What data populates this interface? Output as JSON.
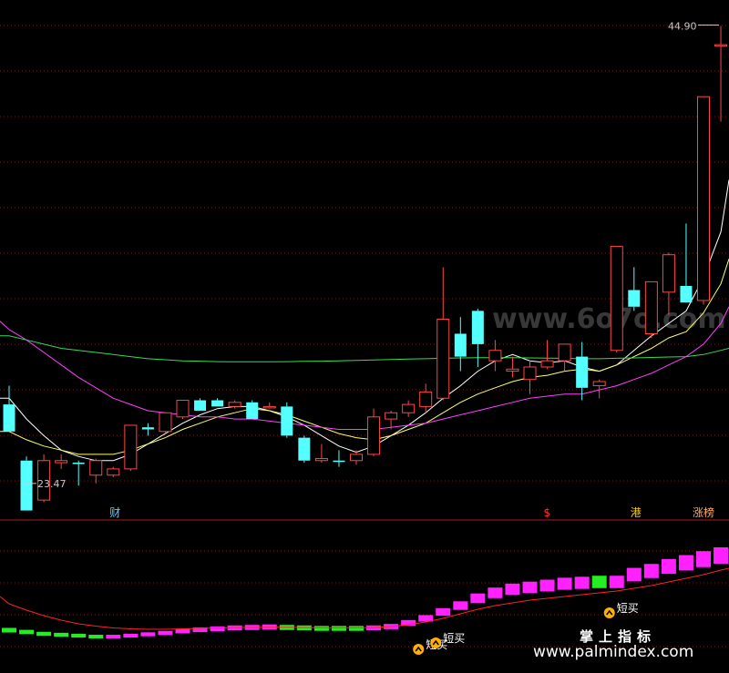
{
  "chart_data": [
    {
      "type": "candlestick",
      "price_labels": {
        "high": "44.90",
        "low": "23.47"
      },
      "ylim": [
        22.5,
        45.8
      ],
      "candles": [
        {
          "o": 26.7,
          "h": 27.6,
          "l": 25.5,
          "c": 25.4,
          "dir": "down"
        },
        {
          "o": 24.0,
          "h": 24.2,
          "l": 23.47,
          "c": 21.6,
          "dir": "down"
        },
        {
          "o": 22.1,
          "h": 24.3,
          "l": 22.0,
          "c": 24.0,
          "dir": "up"
        },
        {
          "o": 24.0,
          "h": 24.3,
          "l": 23.6,
          "c": 23.9,
          "dir": "up"
        },
        {
          "o": 23.9,
          "h": 24.0,
          "l": 22.8,
          "c": 23.85,
          "dir": "down"
        },
        {
          "o": 23.3,
          "h": 24.1,
          "l": 22.9,
          "c": 24.0,
          "dir": "up"
        },
        {
          "o": 23.3,
          "h": 23.7,
          "l": 23.2,
          "c": 23.6,
          "dir": "up"
        },
        {
          "o": 23.6,
          "h": 25.7,
          "l": 23.5,
          "c": 25.7,
          "dir": "up"
        },
        {
          "o": 25.6,
          "h": 25.8,
          "l": 25.2,
          "c": 25.5,
          "dir": "down"
        },
        {
          "o": 25.4,
          "h": 26.3,
          "l": 25.3,
          "c": 26.3,
          "dir": "up"
        },
        {
          "o": 26.1,
          "h": 26.8,
          "l": 26.0,
          "c": 26.9,
          "dir": "up"
        },
        {
          "o": 26.9,
          "h": 27.0,
          "l": 26.4,
          "c": 26.4,
          "dir": "down"
        },
        {
          "o": 26.9,
          "h": 27.0,
          "l": 26.6,
          "c": 26.6,
          "dir": "down"
        },
        {
          "o": 26.6,
          "h": 26.9,
          "l": 26.5,
          "c": 26.8,
          "dir": "up"
        },
        {
          "o": 26.8,
          "h": 26.9,
          "l": 26.0,
          "c": 26.0,
          "dir": "down"
        },
        {
          "o": 26.6,
          "h": 26.8,
          "l": 26.5,
          "c": 26.6,
          "dir": "up"
        },
        {
          "o": 26.6,
          "h": 26.8,
          "l": 25.1,
          "c": 25.2,
          "dir": "down"
        },
        {
          "o": 25.1,
          "h": 25.2,
          "l": 23.9,
          "c": 24.0,
          "dir": "down"
        },
        {
          "o": 24.0,
          "h": 24.8,
          "l": 23.9,
          "c": 24.1,
          "dir": "up"
        },
        {
          "o": 24.0,
          "h": 24.5,
          "l": 23.7,
          "c": 24.0,
          "dir": "down"
        },
        {
          "o": 24.0,
          "h": 24.5,
          "l": 23.8,
          "c": 24.3,
          "dir": "up"
        },
        {
          "o": 24.3,
          "h": 26.5,
          "l": 24.2,
          "c": 26.1,
          "dir": "up"
        },
        {
          "o": 26.0,
          "h": 26.4,
          "l": 25.5,
          "c": 26.3,
          "dir": "up"
        },
        {
          "o": 26.3,
          "h": 26.9,
          "l": 26.1,
          "c": 26.7,
          "dir": "up"
        },
        {
          "o": 26.6,
          "h": 27.7,
          "l": 26.3,
          "c": 27.3,
          "dir": "up"
        },
        {
          "o": 27.0,
          "h": 33.3,
          "l": 26.9,
          "c": 30.8,
          "dir": "up"
        },
        {
          "o": 30.1,
          "h": 30.9,
          "l": 28.3,
          "c": 29.0,
          "dir": "down"
        },
        {
          "o": 31.2,
          "h": 31.3,
          "l": 28.5,
          "c": 29.6,
          "dir": "down"
        },
        {
          "o": 28.8,
          "h": 29.8,
          "l": 28.3,
          "c": 29.3,
          "dir": "up"
        },
        {
          "o": 28.3,
          "h": 29.0,
          "l": 28.0,
          "c": 28.4,
          "dir": "up"
        },
        {
          "o": 27.9,
          "h": 28.8,
          "l": 27.2,
          "c": 28.5,
          "dir": "up"
        },
        {
          "o": 28.5,
          "h": 29.8,
          "l": 28.4,
          "c": 28.8,
          "dir": "up"
        },
        {
          "o": 28.8,
          "h": 29.6,
          "l": 28.3,
          "c": 29.6,
          "dir": "up"
        },
        {
          "o": 29.0,
          "h": 29.7,
          "l": 26.9,
          "c": 27.5,
          "dir": "down"
        },
        {
          "o": 27.6,
          "h": 27.9,
          "l": 27.0,
          "c": 27.8,
          "dir": "up"
        },
        {
          "o": 29.3,
          "h": 34.3,
          "l": 29.2,
          "c": 34.3,
          "dir": "up"
        },
        {
          "o": 32.2,
          "h": 33.3,
          "l": 31.2,
          "c": 31.4,
          "dir": "down"
        },
        {
          "o": 30.1,
          "h": 32.6,
          "l": 29.9,
          "c": 32.6,
          "dir": "up"
        },
        {
          "o": 32.1,
          "h": 34.0,
          "l": 31.0,
          "c": 33.9,
          "dir": "up"
        },
        {
          "o": 32.4,
          "h": 35.4,
          "l": 31.7,
          "c": 31.6,
          "dir": "down"
        },
        {
          "o": 31.7,
          "h": 41.5,
          "l": 31.5,
          "c": 41.5,
          "dir": "up"
        },
        {
          "o": 44.0,
          "h": 44.9,
          "l": 40.3,
          "c": 44.0,
          "dir": "up"
        }
      ],
      "moving_averages": [
        {
          "color": "#ffffff",
          "values": [
            27.0,
            26.0,
            25.2,
            24.5,
            24.2,
            24.0,
            24.0,
            24.3,
            24.8,
            25.3,
            25.8,
            26.2,
            26.5,
            26.6,
            26.6,
            26.4,
            26.1,
            25.7,
            25.2,
            24.7,
            24.4,
            24.7,
            25.2,
            25.7,
            26.3,
            27.0,
            27.6,
            28.3,
            28.8,
            29.1,
            28.8,
            28.7,
            28.8,
            28.5,
            28.3,
            28.6,
            29.3,
            30.0,
            30.6,
            31.2,
            32.8,
            35.0
          ]
        },
        {
          "color": "#ffff66",
          "values": [
            25.4,
            25.0,
            24.7,
            24.5,
            24.3,
            24.3,
            24.3,
            24.5,
            24.8,
            25.1,
            25.5,
            25.8,
            26.1,
            26.3,
            26.5,
            26.4,
            26.2,
            25.9,
            25.6,
            25.3,
            25.1,
            25.0,
            25.2,
            25.5,
            25.8,
            26.3,
            26.8,
            27.2,
            27.5,
            27.8,
            28.0,
            28.1,
            28.3,
            28.4,
            28.3,
            28.6,
            29.0,
            29.4,
            29.9,
            30.2,
            31.1,
            32.5
          ]
        },
        {
          "color": "#ff40ff",
          "values": [
            30.3,
            29.8,
            29.2,
            28.6,
            28.0,
            27.5,
            27.0,
            26.7,
            26.4,
            26.3,
            26.2,
            26.1,
            26.1,
            26.0,
            26.0,
            25.9,
            25.8,
            25.7,
            25.6,
            25.5,
            25.5,
            25.5,
            25.6,
            25.7,
            25.8,
            26.0,
            26.2,
            26.4,
            26.6,
            26.8,
            27.0,
            27.1,
            27.2,
            27.2,
            27.4,
            27.6,
            27.9,
            28.2,
            28.6,
            29.0,
            29.6,
            30.6
          ]
        },
        {
          "color": "#33dd55",
          "values": [
            30.0,
            29.8,
            29.6,
            29.4,
            29.3,
            29.2,
            29.1,
            29.0,
            28.9,
            28.85,
            28.8,
            28.78,
            28.76,
            28.75,
            28.75,
            28.75,
            28.76,
            28.77,
            28.78,
            28.8,
            28.82,
            28.84,
            28.86,
            28.88,
            28.9,
            28.92,
            28.94,
            28.95,
            28.95,
            28.95,
            28.94,
            28.93,
            28.92,
            28.9,
            28.9,
            28.92,
            28.94,
            28.96,
            28.98,
            29.0,
            29.1,
            29.3
          ]
        }
      ],
      "markers": [
        {
          "index": 6,
          "text": "财",
          "color": "#66ccff"
        },
        {
          "index": 31,
          "text": "$",
          "color": "#ff3333"
        },
        {
          "index": 36,
          "text": "港",
          "color": "#ffcc00"
        },
        {
          "index": 40,
          "text": "涨榜",
          "color": "#ffaa66"
        }
      ],
      "watermark": "www.6o7o.com"
    },
    {
      "type": "bar",
      "ylim": [
        0,
        10
      ],
      "values": [
        1.3,
        1.1,
        0.9,
        0.8,
        0.7,
        0.6,
        0.6,
        0.7,
        0.85,
        1.0,
        1.2,
        1.35,
        1.45,
        1.55,
        1.6,
        1.65,
        1.6,
        1.55,
        1.5,
        1.5,
        1.5,
        1.55,
        1.7,
        2.1,
        2.6,
        3.3,
        4.0,
        4.8,
        5.4,
        5.8,
        6.0,
        6.2,
        6.4,
        6.5,
        6.6,
        6.6,
        7.4,
        7.8,
        8.3,
        8.7,
        9.1,
        9.5
      ],
      "colors": [
        "g",
        "g",
        "g",
        "g",
        "g",
        "g",
        "m",
        "m",
        "m",
        "m",
        "m",
        "m",
        "m",
        "m",
        "m",
        "m",
        "g",
        "g",
        "g",
        "g",
        "g",
        "m",
        "m",
        "m",
        "m",
        "m",
        "m",
        "m",
        "m",
        "m",
        "m",
        "m",
        "m",
        "m",
        "g",
        "m",
        "m",
        "m",
        "m",
        "m",
        "m",
        "m"
      ],
      "line": [
        4.2,
        3.5,
        2.9,
        2.4,
        2.0,
        1.75,
        1.55,
        1.45,
        1.4,
        1.4,
        1.45,
        1.5,
        1.55,
        1.6,
        1.6,
        1.62,
        1.62,
        1.6,
        1.58,
        1.57,
        1.57,
        1.6,
        1.7,
        1.9,
        2.2,
        2.6,
        3.1,
        3.6,
        4.0,
        4.3,
        4.6,
        4.8,
        5.0,
        5.2,
        5.4,
        5.6,
        5.9,
        6.2,
        6.6,
        7.0,
        7.4,
        7.9
      ],
      "signals": [
        {
          "index": 24,
          "text": "短买"
        },
        {
          "index": 25,
          "text": "短买"
        },
        {
          "index": 35,
          "text": "短买"
        }
      ],
      "brand": {
        "cn": "掌上指标",
        "url": "www.palmindex.com"
      }
    }
  ]
}
